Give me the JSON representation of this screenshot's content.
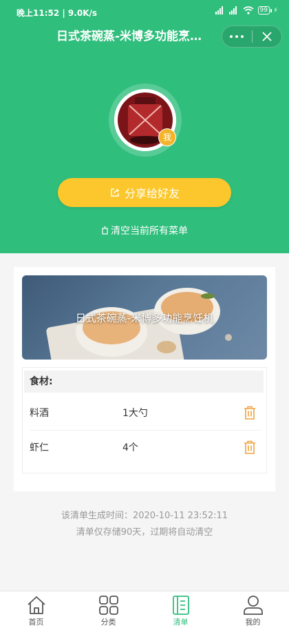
{
  "status_bar": {
    "time": "晚上11:52 | 9.0K/s",
    "battery": "99"
  },
  "nav": {
    "title": "日式茶碗蒸-米博多功能烹…",
    "more_icon": "more-dots-icon",
    "close_icon": "close-icon"
  },
  "profile": {
    "badge": "我"
  },
  "actions": {
    "share_label": "分享给好友",
    "clear_label": "清空当前所有菜单"
  },
  "recipe": {
    "title": "日式茶碗蒸-米博多功能烹饪机",
    "ingredients_header": "食材:",
    "ingredients": [
      {
        "name": "料酒",
        "qty": "1大勺"
      },
      {
        "name": "虾仁",
        "qty": "4个"
      }
    ]
  },
  "footer": {
    "generated": "该清单生成时间：2020-10-11 23:52:11",
    "retention": "清单仅存储90天，过期将自动清空"
  },
  "tabbar": {
    "items": [
      {
        "label": "首页",
        "icon": "home-icon"
      },
      {
        "label": "分类",
        "icon": "grid-icon"
      },
      {
        "label": "清单",
        "icon": "list-icon"
      },
      {
        "label": "我的",
        "icon": "user-icon"
      }
    ],
    "active_index": 2
  },
  "colors": {
    "primary": "#2fbe7c",
    "button": "#fbc72c",
    "trash": "#f0a23c"
  }
}
